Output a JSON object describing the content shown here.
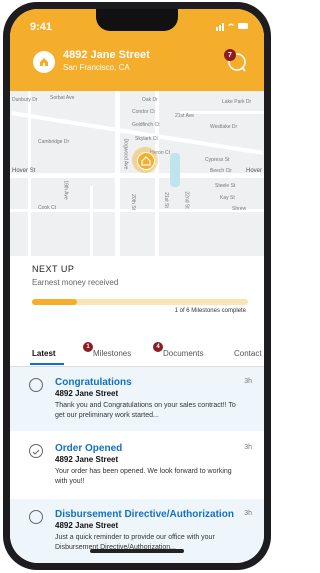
{
  "status_bar": {
    "time": "9:41",
    "icons": "signal wifi battery"
  },
  "header": {
    "address": "4892 Jane Street",
    "city": "San Francisco, CA",
    "chat_badge": "7",
    "accent": "#f5ad2c"
  },
  "map": {
    "labels": [
      "Dunbury Dr",
      "Sorbat Ave",
      "Oak Dr",
      "Lake Park Dr",
      "Condor Ct",
      "Goldfinch Ct",
      "21st Ave",
      "Westlake Dr",
      "Cambridge Dr",
      "Skylark Ct",
      "Heron Ct",
      "Cypress St",
      "Beech Cir",
      "Dogwood Ave",
      "Hover St",
      "Hover",
      "Steele St",
      "Kay St",
      "Cook Ct",
      "Shrew",
      "18th Ave",
      "20th St",
      "21st St",
      "22nd St"
    ]
  },
  "progress": {
    "title": "NEXT UP",
    "subtitle": "Earnest money received",
    "fraction": 0.21,
    "milestones_text": "1 of 6 Milestones complete"
  },
  "tabs": [
    {
      "label": "Latest"
    },
    {
      "label": "Milestones",
      "badge": "1"
    },
    {
      "label": "Documents",
      "badge": "4"
    },
    {
      "label": "Contact"
    }
  ],
  "feed": [
    {
      "title": "Congratulations",
      "address": "4892 Jane Street",
      "body": "Thank you and Congratulations on your sales contract!! To get our preliminary work started...",
      "time": "3h",
      "checked": false
    },
    {
      "title": "Order Opened",
      "address": "4892 Jane Street",
      "body": "Your order has been opened. We look forward to working with you!!",
      "time": "3h",
      "checked": true
    },
    {
      "title": "Disbursement Directive/Authorization",
      "address": "4892 Jane Street",
      "body": "Just a quick reminder to provide our office with your Disbursement Directive/Authorization...",
      "time": "3h",
      "checked": false
    }
  ],
  "colors": {
    "link": "#1271c4",
    "badge": "#8b1c21",
    "item_bg": "#eef6fb"
  }
}
